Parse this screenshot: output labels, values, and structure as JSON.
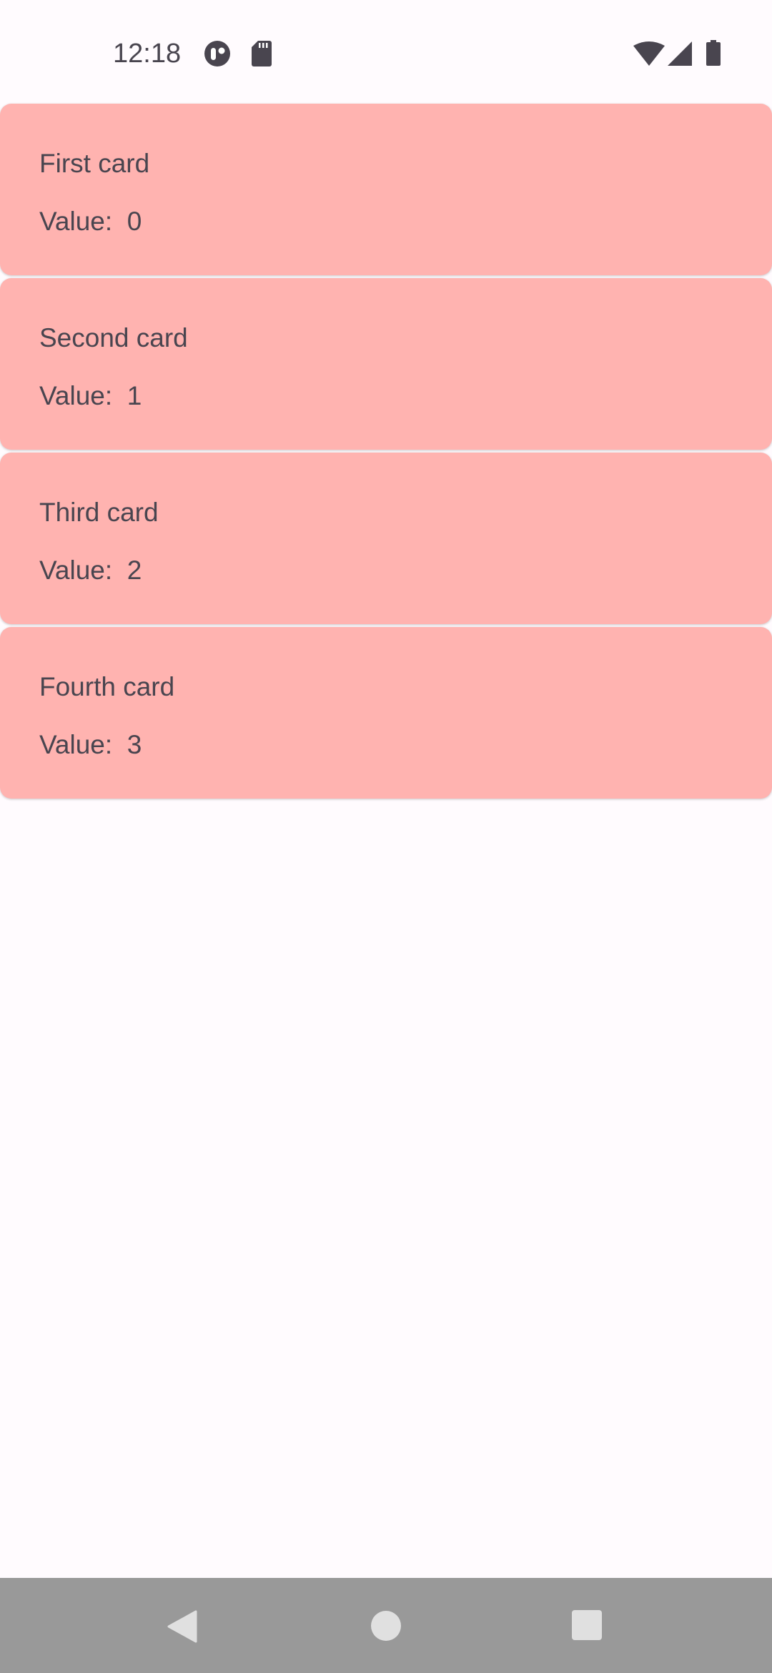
{
  "status_bar": {
    "time": "12:18",
    "left_icons": [
      "app-notification-icon",
      "sd-card-icon"
    ],
    "right_icons": [
      "wifi-icon",
      "cell-signal-icon",
      "battery-icon"
    ]
  },
  "cards": [
    {
      "title": "First card",
      "value_label": "Value:  0"
    },
    {
      "title": "Second card",
      "value_label": "Value:  1"
    },
    {
      "title": "Third card",
      "value_label": "Value:  2"
    },
    {
      "title": "Fourth card",
      "value_label": "Value:  3"
    }
  ],
  "nav_bar": {
    "buttons": [
      "back-icon",
      "home-icon",
      "recents-icon"
    ]
  },
  "colors": {
    "background": "#FFFBFE",
    "card": "#FFB3B0",
    "text": "#49454F",
    "nav_bar": "#999999",
    "nav_button": "#E0E0E0"
  }
}
